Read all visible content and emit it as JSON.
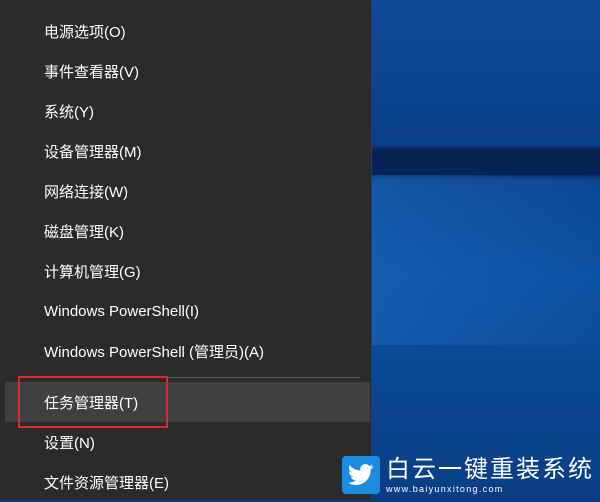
{
  "menu": {
    "items": [
      {
        "label": "电源选项(O)"
      },
      {
        "label": "事件查看器(V)"
      },
      {
        "label": "系统(Y)"
      },
      {
        "label": "设备管理器(M)"
      },
      {
        "label": "网络连接(W)"
      },
      {
        "label": "磁盘管理(K)"
      },
      {
        "label": "计算机管理(G)"
      },
      {
        "label": "Windows PowerShell(I)"
      },
      {
        "label": "Windows PowerShell (管理员)(A)"
      },
      {
        "label": "任务管理器(T)"
      },
      {
        "label": "设置(N)"
      },
      {
        "label": "文件资源管理器(E)"
      }
    ]
  },
  "watermark": {
    "title": "白云一键重装系统",
    "url": "www.baiyunxitong.com"
  },
  "colors": {
    "menu_bg": "#2b2b2b",
    "hover_bg": "#404040",
    "annotation_box": "#e0282a",
    "watermark_logo": "#1d8be0"
  },
  "icons": {
    "watermark_logo": "twitter-bird-icon"
  }
}
